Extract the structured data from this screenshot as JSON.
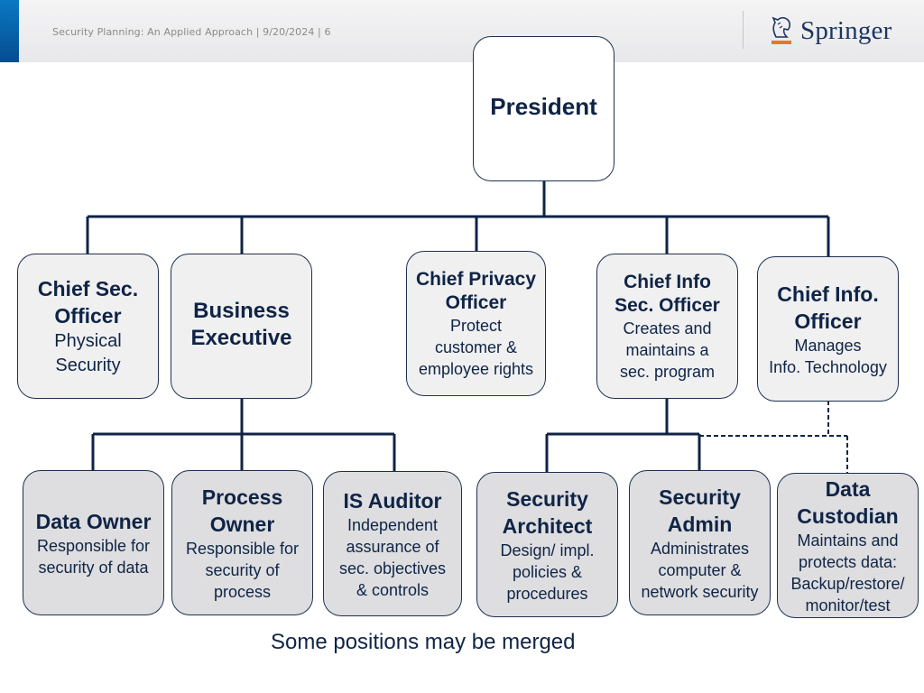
{
  "header": {
    "text": "Security Planning: An Applied Approach | 9/20/2024 | 6",
    "logo": {
      "icon": "horse-head-icon",
      "label": "Springer",
      "underline_color": "#e07b20"
    }
  },
  "colors": {
    "line": "#0f2446",
    "box_border": "#1f3150",
    "text": "#0f2446",
    "accent": "#0a6db8"
  },
  "org_chart": {
    "president": {
      "title": "President",
      "desc": ""
    },
    "level2": [
      {
        "id": "chief-sec-officer",
        "title": "Chief Sec.\nOfficer",
        "desc": "Physical\nSecurity"
      },
      {
        "id": "business-executive",
        "title": "Business\nExecutive",
        "desc": ""
      },
      {
        "id": "chief-privacy-officer",
        "title": "Chief Privacy\nOfficer",
        "desc": "Protect\ncustomer &\nemployee rights"
      },
      {
        "id": "chief-info-sec-officer",
        "title": "Chief Info\nSec. Officer",
        "desc": "Creates and\nmaintains a\nsec. program"
      },
      {
        "id": "chief-info-officer",
        "title": "Chief Info.\nOfficer",
        "desc": "Manages\nInfo. Technology"
      }
    ],
    "level3": [
      {
        "id": "data-owner",
        "title": "Data Owner",
        "desc": "Responsible for\nsecurity of data",
        "reports_to": "business-executive"
      },
      {
        "id": "process-owner",
        "title": "Process\nOwner",
        "desc": "Responsible for\nsecurity of\nprocess",
        "reports_to": "business-executive"
      },
      {
        "id": "is-auditor",
        "title": "IS Auditor",
        "desc": "Independent\nassurance of\nsec. objectives\n& controls",
        "reports_to": "business-executive"
      },
      {
        "id": "security-architect",
        "title": "Security\nArchitect",
        "desc": "Design/ impl.\npolicies &\nprocedures",
        "reports_to": "chief-info-sec-officer"
      },
      {
        "id": "security-admin",
        "title": "Security\nAdmin",
        "desc": "Administrates\ncomputer &\nnetwork security",
        "reports_to": "chief-info-sec-officer"
      },
      {
        "id": "data-custodian",
        "title": "Data\nCustodian",
        "desc": "Maintains and\nprotects data:\nBackup/restore/\nmonitor/test",
        "reports_to": "chief-info-officer",
        "dotted_line_to": "chief-info-sec-officer"
      }
    ]
  },
  "caption": "Some positions may be merged"
}
